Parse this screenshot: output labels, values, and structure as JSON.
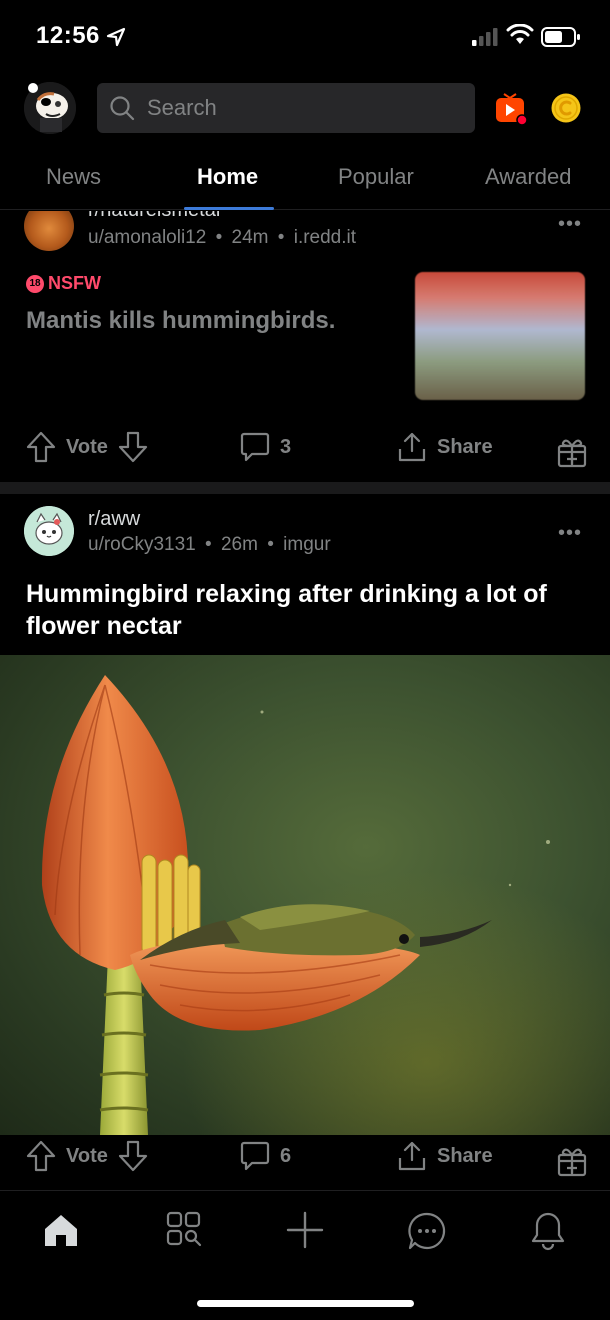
{
  "status_bar": {
    "time": "12:56"
  },
  "search": {
    "placeholder": "Search"
  },
  "tabs": [
    {
      "label": "News",
      "active": false
    },
    {
      "label": "Home",
      "active": true
    },
    {
      "label": "Popular",
      "active": false
    },
    {
      "label": "Awarded",
      "active": false
    }
  ],
  "posts": [
    {
      "subreddit": "r/natureismetal",
      "user": "u/amonaloli12",
      "age": "24m",
      "domain": "i.redd.it",
      "tag": "NSFW",
      "tag_badge": "18",
      "title": "Mantis kills hummingbirds.",
      "vote_label": "Vote",
      "comments": "3",
      "share_label": "Share"
    },
    {
      "subreddit": "r/aww",
      "user": "u/roCky3131",
      "age": "26m",
      "domain": "imgur",
      "title": "Hummingbird relaxing after drinking a lot of flower nectar",
      "vote_label": "Vote",
      "comments": "6",
      "share_label": "Share"
    }
  ],
  "meta_separator": "•",
  "more_glyph": "•••",
  "icons": {
    "top_bar": [
      "avatar",
      "search-icon",
      "video-icon",
      "coin-icon"
    ],
    "bottom_nav": [
      "home-icon",
      "browse-icon",
      "create-icon",
      "chat-icon",
      "notifications-icon"
    ]
  },
  "colors": {
    "background": "#000000",
    "tab_active_underline": "#3d7bd9",
    "nsfw": "#ff4a6b",
    "muted_text": "#818384",
    "coin": "#f5c518",
    "video_button": "#ff4500"
  }
}
